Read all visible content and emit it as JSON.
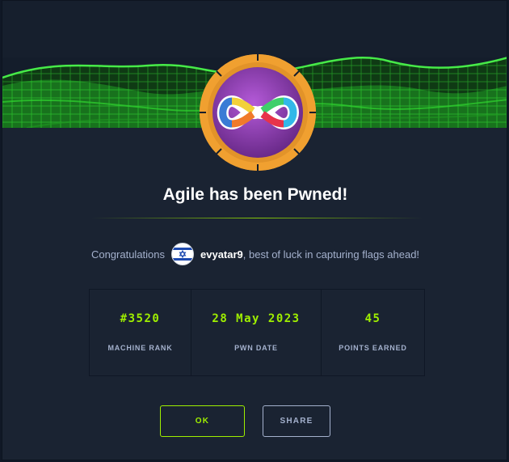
{
  "dialog": {
    "title": "Agile has been Pwned!",
    "machine_logo_icon": "agile-infinity-logo-icon",
    "banner_image": "green-circuit-wave-banner"
  },
  "congrats": {
    "prefix": "Congratulations",
    "avatar_icon": "israel-flag-avatar-icon",
    "username": "evyatar9",
    "suffix": ", best of luck in capturing flags ahead!"
  },
  "stats": [
    {
      "value": "#3520",
      "label": "MACHINE RANK"
    },
    {
      "value": "28 May 2023",
      "label": "PWN DATE"
    },
    {
      "value": "45",
      "label": "POINTS EARNED"
    }
  ],
  "buttons": {
    "ok_label": "OK",
    "share_label": "SHARE"
  },
  "colors": {
    "accent_green": "#9fef00",
    "background": "#1a2332",
    "logo_ring": "#f0a030",
    "logo_core": "#8a3fb0"
  }
}
